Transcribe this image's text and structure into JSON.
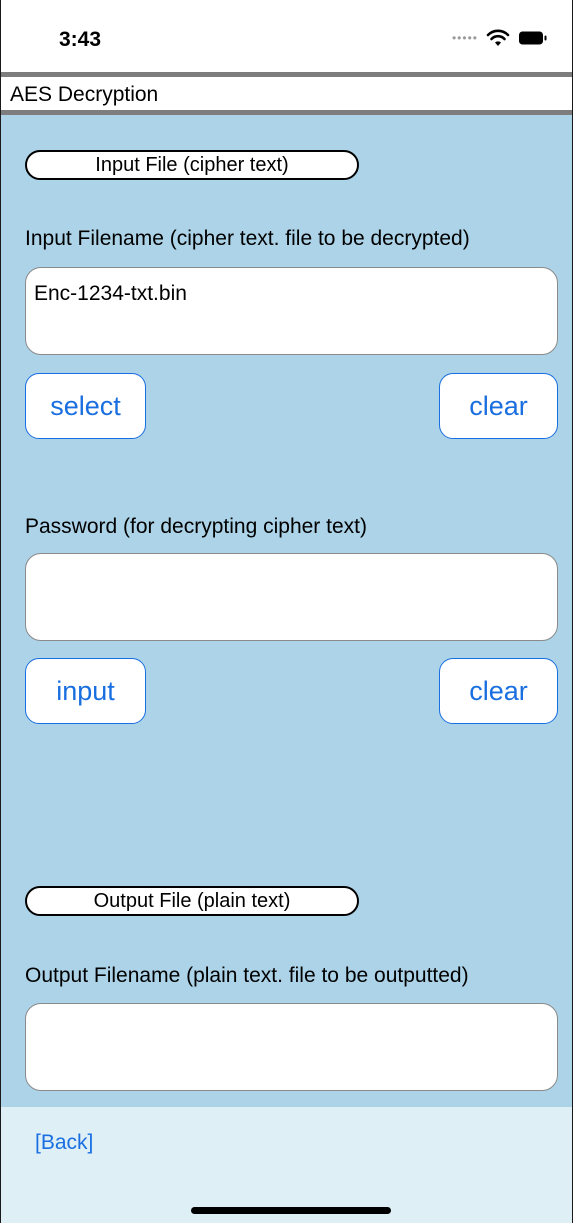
{
  "status_bar": {
    "time": "3:43",
    "icons": [
      "signal-dots-icon",
      "wifi-icon",
      "battery-icon"
    ]
  },
  "title_bar": {
    "title": "AES Decryption"
  },
  "input_section": {
    "header": "Input File (cipher text)",
    "filename_label": "Input Filename (cipher text. file to be decrypted)",
    "filename_value": "Enc-1234-txt.bin",
    "select_label": "select",
    "clear_label": "clear"
  },
  "password_section": {
    "label": "Password (for decrypting cipher text)",
    "value": "",
    "input_label": "input",
    "clear_label": "clear"
  },
  "output_section": {
    "header": "Output File (plain text)",
    "filename_label": "Output Filename (plain text. file to be outputted)",
    "filename_value": ""
  },
  "bottom_bar": {
    "back_label": "[Back]"
  },
  "colors": {
    "content_background": "#acd3e8",
    "bottom_bar_background": "#dfeff6",
    "accent": "#1a6fe0",
    "rule": "#7d7d7d"
  }
}
